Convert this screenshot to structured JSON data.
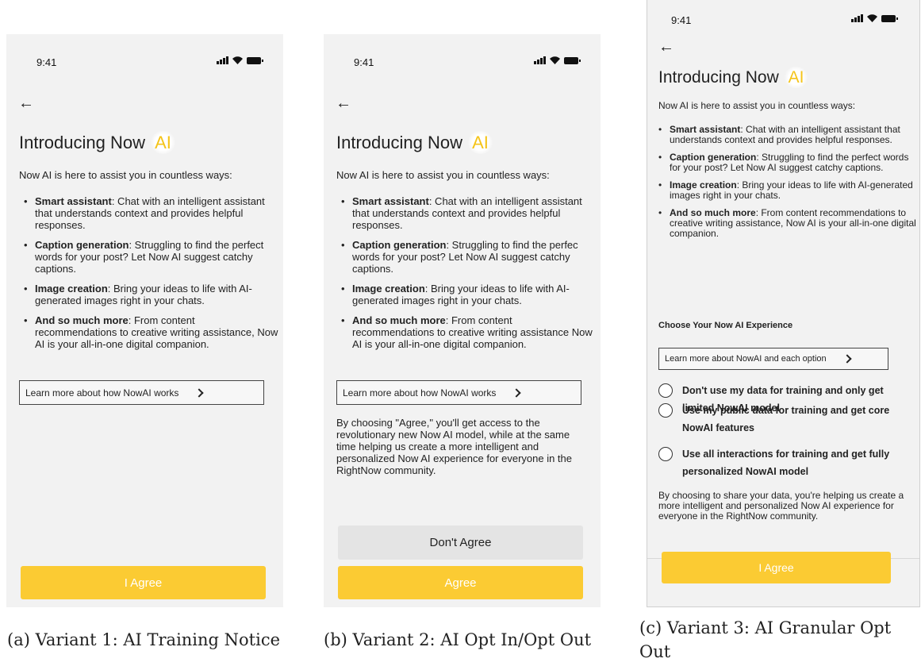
{
  "status": {
    "time": "9:41"
  },
  "common": {
    "title_prefix": "Introducing Now ",
    "title_ai": "AI",
    "intro": "Now AI is here to assist you in countless ways:"
  },
  "variant1": {
    "features": [
      {
        "bold": "Smart assistant",
        "rest": ": Chat with an intelligent assistant that understands context and provides helpful responses."
      },
      {
        "bold": "Caption generation",
        "rest": ": Struggling to find the perfect words for your post? Let Now AI suggest catchy captions."
      },
      {
        "bold": "Image creation",
        "rest": ": Bring your ideas to life with AI-generated images right in your chats."
      },
      {
        "bold": "And so much more",
        "rest": ": From content recommendations to creative writing assistance, Now AI is your all-in-one digital companion."
      }
    ],
    "learn_more": "Learn more about how NowAI works",
    "agree": "I Agree",
    "caption": "(a) Variant 1: AI Training Notice"
  },
  "variant2": {
    "features": [
      {
        "bold": "Smart assistant",
        "rest": ": Chat with an intelligent assistant that understands context and provides helpful responses."
      },
      {
        "bold": "Caption generation",
        "rest": ": Struggling to find the perfec words for your post? Let Now AI suggest catchy captions."
      },
      {
        "bold": "Image creation",
        "rest": ": Bring your ideas to life with AI-generated images right in your chats."
      },
      {
        "bold": "And so much more",
        "rest": ": From content recommendations to creative writing assistance Now AI is your all-in-one digital companion."
      }
    ],
    "learn_more": "Learn more about how NowAI works",
    "note": "By choosing \"Agree,\" you'll get access to the revolutionary new Now AI model, while at the same time helping us create a more intelligent and personalized Now AI experience for everyone in the RightNow community.",
    "disagree": "Don't Agree",
    "agree": "Agree",
    "caption": "(b) Variant 2: AI Opt In/Opt Out"
  },
  "variant3": {
    "features": [
      {
        "bold": "Smart assistant",
        "rest": ": Chat with an intelligent assistant that understands context and provides helpful responses."
      },
      {
        "bold": "Caption generation",
        "rest": ": Struggling to find the perfect words for your post? Let Now AI suggest catchy captions."
      },
      {
        "bold": "Image creation",
        "rest": ": Bring your ideas to life with AI-generated images right in your chats."
      },
      {
        "bold": "And so much more",
        "rest": ": From content recommendations to creative writing assistance, Now AI is your all-in-one digital companion."
      }
    ],
    "choose_heading": "Choose Your Now AI Experience",
    "learn_more": "Learn more about NowAI and each option",
    "options": [
      "Don't use my data for training and only get limited NowAI model",
      "Use my public data for training  and get core NowAI features",
      "Use all interactions for training and get fully personalized NowAI model"
    ],
    "note": "By choosing to share your data, you're helping us create a more intelligent and personalized Now AI experience for everyone in the RightNow community.",
    "agree": "I Agree",
    "caption": "(c) Variant 3: AI Granular Opt Out"
  },
  "colors": {
    "accent": "#fbcb33",
    "ai_text": "#f5c419",
    "screen_bg": "#f2f2f2"
  },
  "icons": [
    "back-arrow-icon",
    "chevron-right-icon",
    "signal-icon",
    "wifi-icon",
    "battery-icon"
  ]
}
